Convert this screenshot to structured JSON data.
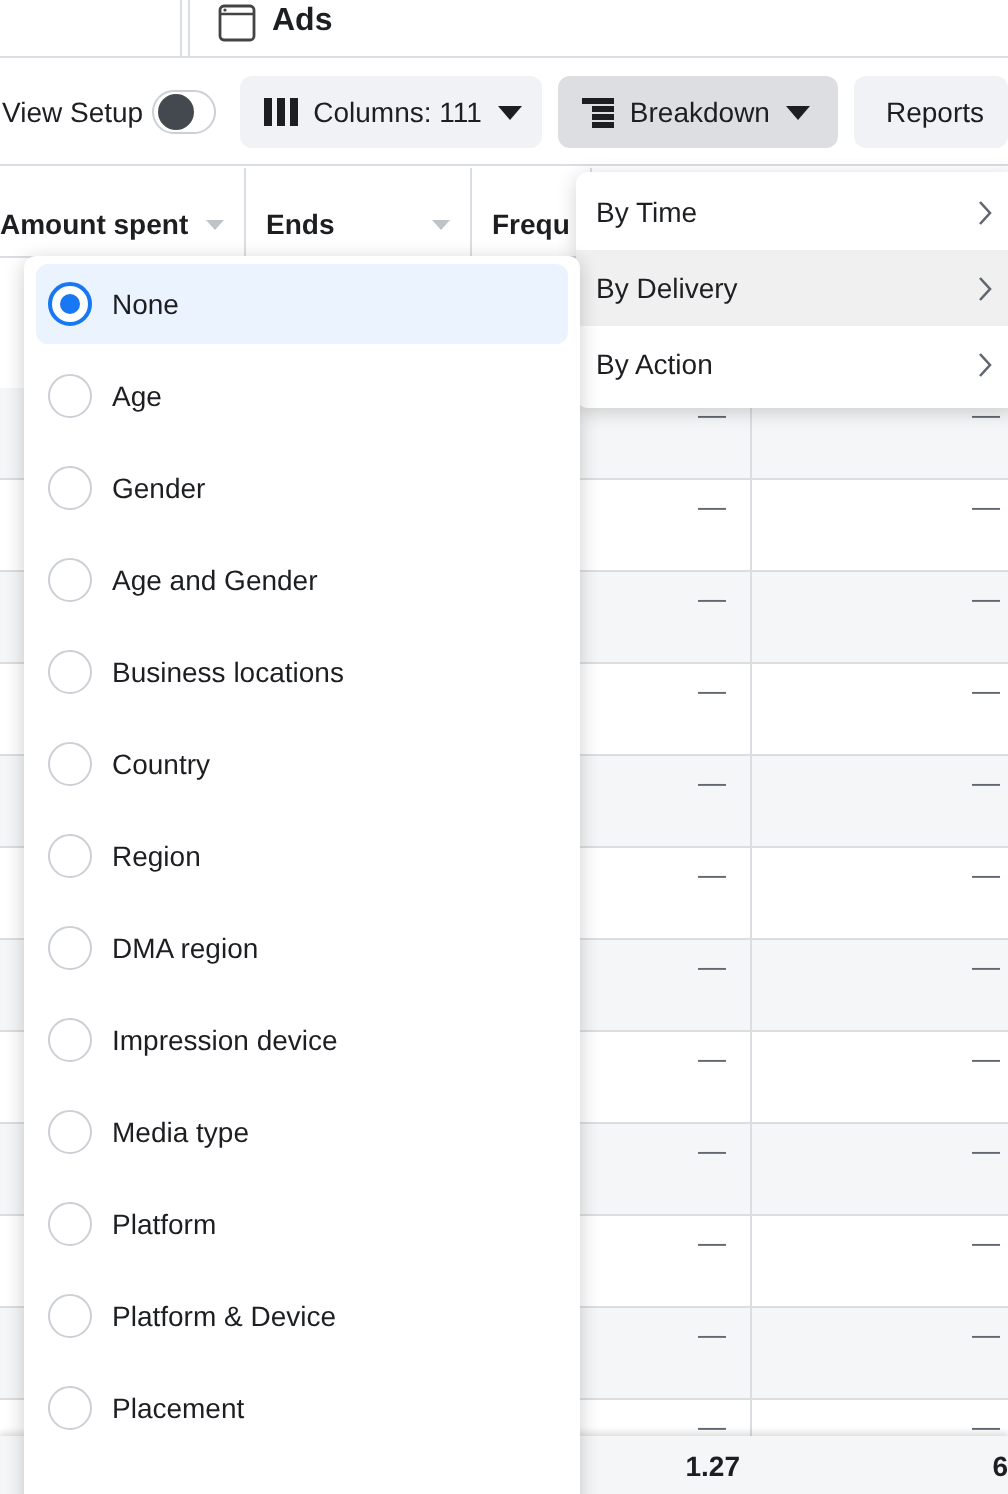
{
  "header": {
    "title": "Ads"
  },
  "toolbar": {
    "view_setup": {
      "label": "View Setup",
      "on": false
    },
    "columns_button": "Columns: 111",
    "breakdown_button": {
      "label": "Breakdown",
      "selected": true
    },
    "reports_button": "Reports"
  },
  "table": {
    "columns": [
      "Amount spent",
      "Ends",
      "Frequ"
    ],
    "rows": [
      {
        "column_4": "—",
        "column_5": "—"
      },
      {
        "column_4": "—",
        "column_5": "—"
      },
      {
        "column_4": "—",
        "column_5": "—"
      },
      {
        "column_4": "—",
        "column_5": "—"
      },
      {
        "column_4": "—",
        "column_5": "—"
      },
      {
        "column_4": "—",
        "column_5": "—"
      },
      {
        "column_4": "—",
        "column_5": "—"
      },
      {
        "column_4": "—",
        "column_5": "—"
      },
      {
        "column_4": "—",
        "column_5": "—"
      },
      {
        "column_4": "—",
        "column_5": "—"
      },
      {
        "column_4": "—",
        "column_5": "—"
      },
      {
        "column_4": "—",
        "column_5": "—"
      }
    ],
    "totals": {
      "column_4": "1.27",
      "column_5": "6"
    }
  },
  "breakdown_menu": {
    "items": [
      {
        "label": "By Time",
        "selected": false
      },
      {
        "label": "By Delivery",
        "selected": true
      },
      {
        "label": "By Action",
        "selected": false
      }
    ]
  },
  "delivery_options": {
    "items": [
      {
        "label": "None",
        "selected": true
      },
      {
        "label": "Age",
        "selected": false
      },
      {
        "label": "Gender",
        "selected": false
      },
      {
        "label": "Age and Gender",
        "selected": false
      },
      {
        "label": "Business locations",
        "selected": false
      },
      {
        "label": "Country",
        "selected": false
      },
      {
        "label": "Region",
        "selected": false
      },
      {
        "label": "DMA region",
        "selected": false
      },
      {
        "label": "Impression device",
        "selected": false
      },
      {
        "label": "Media type",
        "selected": false
      },
      {
        "label": "Platform",
        "selected": false
      },
      {
        "label": "Platform & Device",
        "selected": false
      },
      {
        "label": "Placement",
        "selected": false
      }
    ]
  }
}
